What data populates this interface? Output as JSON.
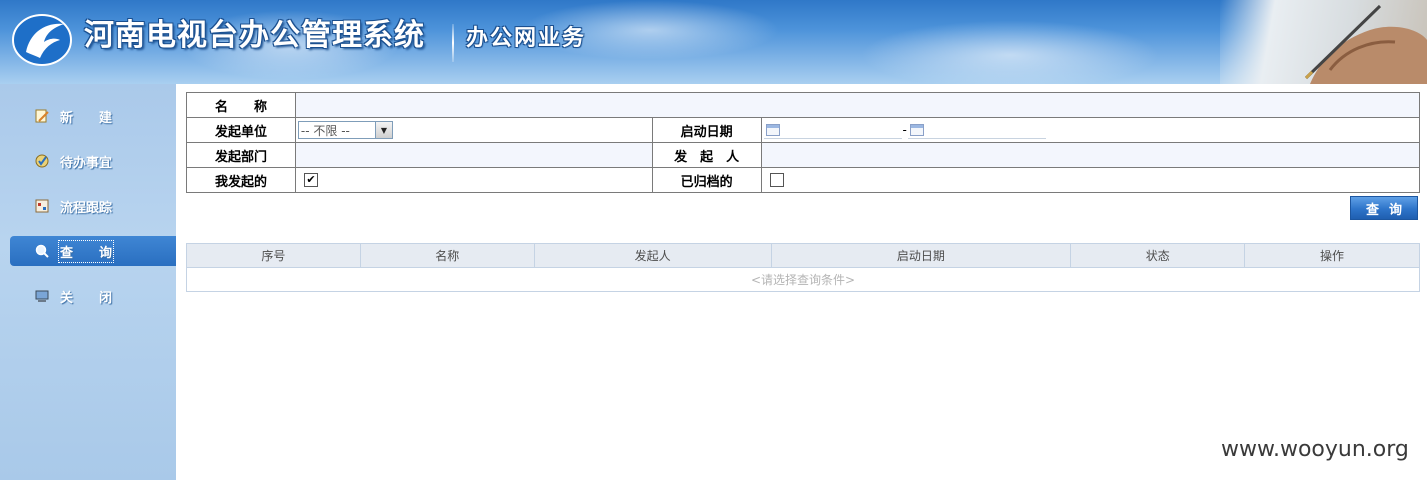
{
  "header": {
    "title": "河南电视台办公管理系统",
    "subtitle": "办公网业务"
  },
  "sidebar": {
    "items": [
      {
        "label": "新　　建",
        "icon": "new-doc-icon"
      },
      {
        "label": "待办事宜",
        "icon": "todo-icon"
      },
      {
        "label": "流程跟踪",
        "icon": "flow-track-icon"
      },
      {
        "label": "查　　询",
        "icon": "search-icon",
        "active": true
      },
      {
        "label": "关　　闭",
        "icon": "computer-icon"
      }
    ]
  },
  "form": {
    "name_label": "名　　称",
    "unit_label": "发起单位",
    "unit_value": "-- 不限 --",
    "start_date_label": "启动日期",
    "date_sep": "-",
    "dept_label": "发起部门",
    "initiator_label": "发　起　人",
    "mine_label": "我发起的",
    "mine_checked": true,
    "archived_label": "已归档的",
    "archived_checked": false
  },
  "query_button": "查询",
  "results": {
    "columns": [
      "序号",
      "名称",
      "发起人",
      "启动日期",
      "状态",
      "操作"
    ],
    "empty_message": "<请选择查询条件>"
  },
  "watermark": "www.wooyun.org",
  "colors": {
    "header_blue": "#2f78c8",
    "active_nav": "#2a6fc0",
    "button_blue": "#2e74c9"
  }
}
